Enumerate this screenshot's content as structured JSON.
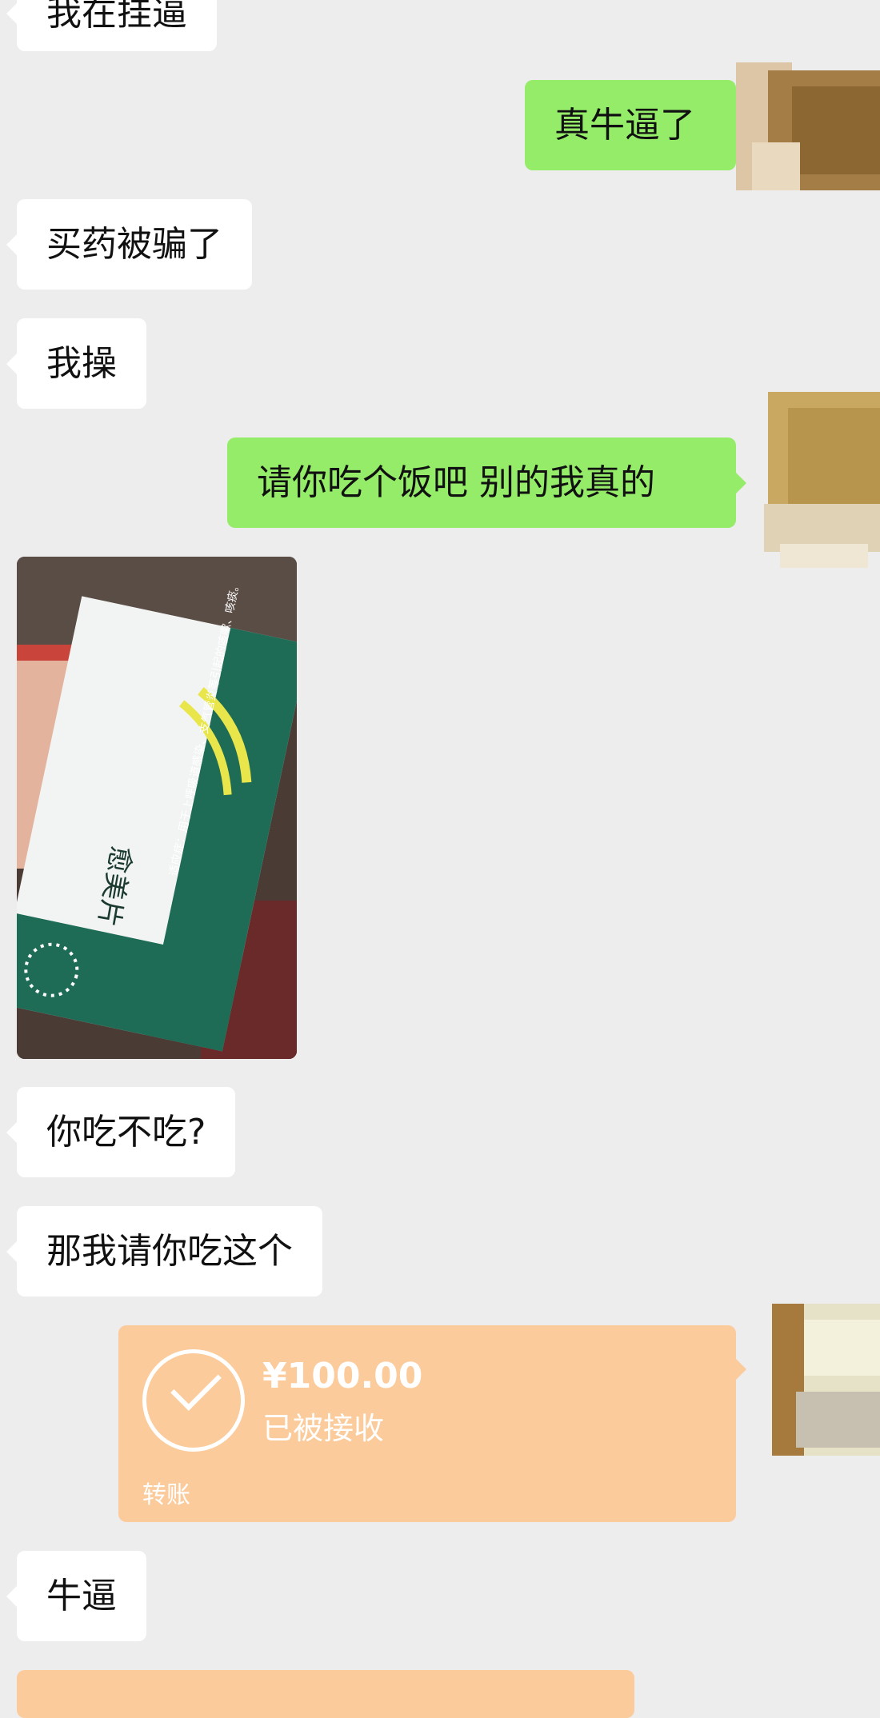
{
  "messages": {
    "m1": "我在挂逼",
    "m2": "真牛逼了",
    "m3": "买药被骗了",
    "m4": "我操",
    "m5": "请你吃个饭吧  别的我真的",
    "m7": "你吃不吃?",
    "m8": "那我请你吃这个",
    "m10": "牛逼"
  },
  "photo": {
    "box_text": "愈美片",
    "indication": "适应症：用于上呼吸道感染、支气管炎等引起的咳嗽、咳痰。"
  },
  "transfer": {
    "amount": "¥100.00",
    "status": "已被接收",
    "type_label": "转账"
  },
  "colors": {
    "background": "#ededed",
    "incoming_bubble": "#ffffff",
    "outgoing_bubble": "#95ec69",
    "transfer_card": "#fbcb9b"
  }
}
